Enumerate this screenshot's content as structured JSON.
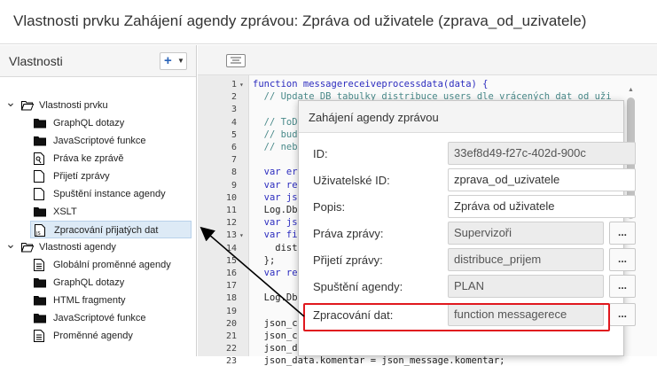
{
  "window": {
    "title": "Vlastnosti prvku Zahájení agendy zprávou: Zpráva od uživatele (zprava_od_uzivatele)"
  },
  "left_panel": {
    "header": "Vlastnosti",
    "add_button": "+",
    "tree": [
      {
        "label": "Vlastnosti prvku",
        "level": 0,
        "icon": "folder-open-icon",
        "expanded": true
      },
      {
        "label": "GraphQL dotazy",
        "level": 1,
        "icon": "folder-icon"
      },
      {
        "label": "JavaScriptové funkce",
        "level": 1,
        "icon": "folder-icon"
      },
      {
        "label": "Práva ke zprávě",
        "level": 1,
        "icon": "rights-doc-icon"
      },
      {
        "label": "Přijetí zprávy",
        "level": 1,
        "icon": "doc-icon"
      },
      {
        "label": "Spuštění instance agendy",
        "level": 1,
        "icon": "doc-icon"
      },
      {
        "label": "XSLT",
        "level": 1,
        "icon": "folder-icon"
      },
      {
        "label": "Zpracování přijatých dat",
        "level": 1,
        "icon": "js-doc-icon",
        "selected": true
      },
      {
        "label": "Vlastnosti agendy",
        "level": 0,
        "icon": "folder-open-icon",
        "expanded": true
      },
      {
        "label": "Globální proměnné agendy",
        "level": 1,
        "icon": "list-doc-icon"
      },
      {
        "label": "GraphQL dotazy",
        "level": 1,
        "icon": "folder-icon",
        "collapsed": true
      },
      {
        "label": "HTML fragmenty",
        "level": 1,
        "icon": "folder-icon"
      },
      {
        "label": "JavaScriptové funkce",
        "level": 1,
        "icon": "folder-icon",
        "collapsed": true
      },
      {
        "label": "Proměnné agendy",
        "level": 1,
        "icon": "list-doc-icon"
      }
    ]
  },
  "editor": {
    "lines": [
      {
        "n": "1",
        "fold": "▾",
        "text": "function messagereceiveprocessdata(data) {"
      },
      {
        "n": "2",
        "text": "  // Update DB tabulky distribuce users dle vrácených dat od uži"
      },
      {
        "n": "3",
        "text": ""
      },
      {
        "n": "4",
        "text": "  // ToD"
      },
      {
        "n": "5",
        "text": "  // bud"
      },
      {
        "n": "6",
        "text": "  // neb"
      },
      {
        "n": "7",
        "text": ""
      },
      {
        "n": "8",
        "text": "  var er"
      },
      {
        "n": "9",
        "text": "  var re"
      },
      {
        "n": "10",
        "text": "  var js"
      },
      {
        "n": "11",
        "text": "  Log.Db"
      },
      {
        "n": "12",
        "text": "  var js"
      },
      {
        "n": "13",
        "fold": "▾",
        "text": "  var fi"
      },
      {
        "n": "14",
        "text": "    dist"
      },
      {
        "n": "15",
        "text": "  };"
      },
      {
        "n": "16",
        "text": "  var re"
      },
      {
        "n": "17",
        "text": ""
      },
      {
        "n": "18",
        "text": "  Log.Db"
      },
      {
        "n": "19",
        "text": ""
      },
      {
        "n": "20",
        "text": "  json_c"
      },
      {
        "n": "21",
        "text": "  json_c"
      },
      {
        "n": "22",
        "text": "  json_data.vyjadreni = json_message.vyjadreni;"
      },
      {
        "n": "23",
        "text": "  json_data.komentar = json_message.komentar;"
      }
    ]
  },
  "popup": {
    "title": "Zahájení agendy zprávou",
    "fields": [
      {
        "label": "ID:",
        "value": "33ef8d49-f27c-402d-900c",
        "readonly": true,
        "has_button": false
      },
      {
        "label": "Uživatelské ID:",
        "value": "zprava_od_uzivatele",
        "readonly": false,
        "has_button": false
      },
      {
        "label": "Popis:",
        "value": "Zpráva od uživatele",
        "readonly": false,
        "has_button": false
      },
      {
        "label": "Práva zprávy:",
        "value": "Supervizoři",
        "readonly": true,
        "has_button": true
      },
      {
        "label": "Přijetí zprávy:",
        "value": "distribuce_prijem",
        "readonly": true,
        "has_button": true
      },
      {
        "label": "Spuštění agendy:",
        "value": "PLAN",
        "readonly": true,
        "has_button": true
      },
      {
        "label": "Zpracování dat:",
        "value": "function messagerece",
        "readonly": true,
        "has_button": true
      }
    ],
    "button_label": "...",
    "highlight_color": "#e0181e"
  }
}
